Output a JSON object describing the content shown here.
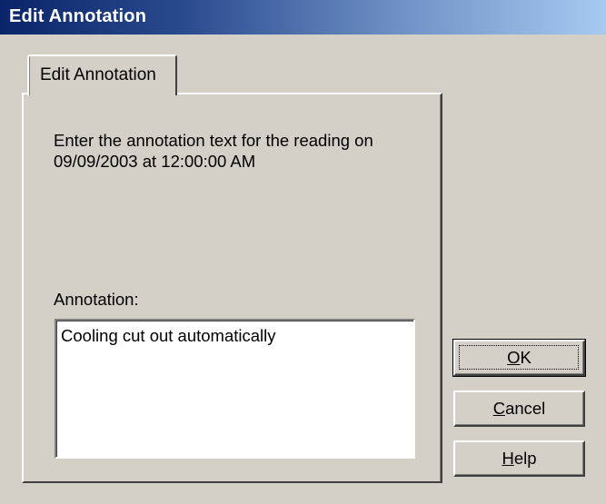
{
  "window": {
    "title": "Edit Annotation"
  },
  "tabs": [
    {
      "label": "Edit Annotation",
      "active": true
    }
  ],
  "prompt": {
    "line1": "Enter the annotation text for the reading on",
    "line2": "09/09/2003 at 12:00:00 AM"
  },
  "annotation": {
    "label": "Annotation:",
    "value": "Cooling cut out automatically"
  },
  "buttons": {
    "ok": {
      "mnemonic": "O",
      "rest": "K"
    },
    "cancel": {
      "mnemonic": "C",
      "rest": "ancel"
    },
    "help": {
      "mnemonic": "H",
      "rest": "elp"
    }
  }
}
